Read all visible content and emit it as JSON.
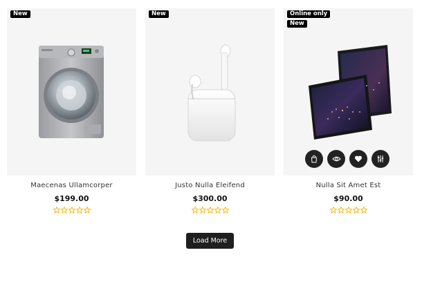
{
  "products": [
    {
      "name": "Maecenas Ullamcorper",
      "price": "$199.00",
      "badges": [
        "New"
      ],
      "rating": 0,
      "rating_max": 5,
      "image": "washing-machine"
    },
    {
      "name": "Justo Nulla Eleifend",
      "price": "$300.00",
      "badges": [
        "New"
      ],
      "rating": 0,
      "rating_max": 5,
      "image": "wireless-earbuds"
    },
    {
      "name": "Nulla Sit Amet Est",
      "price": "$90.00",
      "badges": [
        "Online only",
        "New"
      ],
      "rating": 0,
      "rating_max": 5,
      "image": "tablets",
      "actions": [
        "cart-icon",
        "eye-icon",
        "heart-icon",
        "sliders-icon"
      ]
    }
  ],
  "load_more": {
    "label": "Load More"
  },
  "colors": {
    "badge_bg": "#000000",
    "star": "#f0b400",
    "button_bg": "#1f1f1f",
    "card_bg": "#f5f5f5"
  }
}
